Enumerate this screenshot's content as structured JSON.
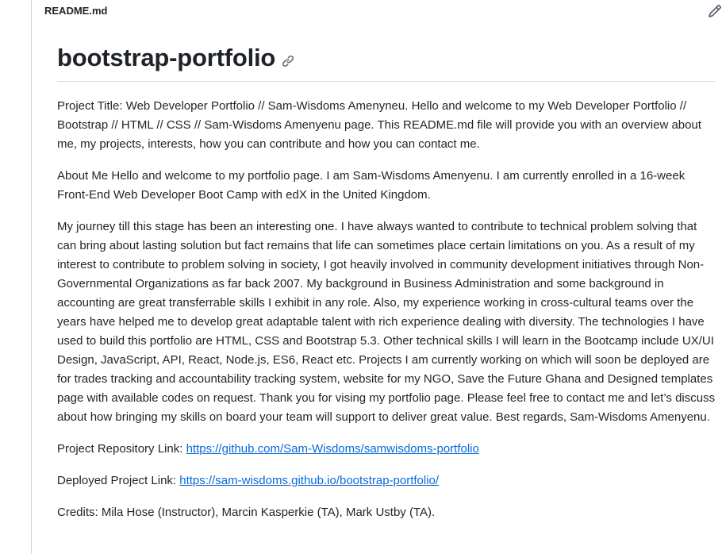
{
  "file_header": {
    "file_name": "README.md",
    "edit_icon": "pencil-icon"
  },
  "readme": {
    "title": "bootstrap-portfolio",
    "anchor_icon": "link-icon",
    "paragraphs": {
      "intro": "Project Title: Web Developer Portfolio // Sam-Wisdoms Amenyneu. Hello and welcome to my Web Developer Portfolio // Bootstrap // HTML // CSS // Sam-Wisdoms Amenyenu page. This README.md file will provide you with an overview about me, my projects, interests, how you can contribute and how you can contact me.",
      "about": "About Me Hello and welcome to my portfolio page. I am Sam-Wisdoms Amenyenu. I am currently enrolled in a 16-week Front-End Web Developer Boot Camp with edX in the United Kingdom.",
      "journey": "My journey till this stage has been an interesting one. I have always wanted to contribute to technical problem solving that can bring about lasting solution but fact remains that life can sometimes place certain limitations on you. As a result of my interest to contribute to problem solving in society, I got heavily involved in community development initiatives through Non-Governmental Organizations as far back 2007. My background in Business Administration and some background in accounting are great transferrable skills I exhibit in any role. Also, my experience working in cross-cultural teams over the years have helped me to develop great adaptable talent with rich experience dealing with diversity. The technologies I have used to build this portfolio are HTML, CSS and Bootstrap 5.3. Other technical skills I will learn in the Bootcamp include UX/UI Design, JavaScript, API, React, Node.js, ES6, React etc. Projects I am currently working on which will soon be deployed are for trades tracking and accountability tracking system, website for my NGO, Save the Future Ghana and Designed templates page with available codes on request. Thank you for vising my portfolio page. Please feel free to contact me and let’s discuss about how bringing my skills on board your team will support to deliver great value. Best regards, Sam-Wisdoms Amenyenu.",
      "repo_label": "Project Repository Link: ",
      "repo_url": "https://github.com/Sam-Wisdoms/samwisdoms-portfolio",
      "deployed_label": "Deployed Project Link: ",
      "deployed_url": "https://sam-wisdoms.github.io/bootstrap-portfolio/",
      "credits": "Credits: Mila Hose (Instructor), Marcin Kasperkie (TA), Mark Ustby (TA)."
    }
  },
  "colors": {
    "text": "#1f2328",
    "link": "#0969da",
    "border": "#d0d7de"
  }
}
